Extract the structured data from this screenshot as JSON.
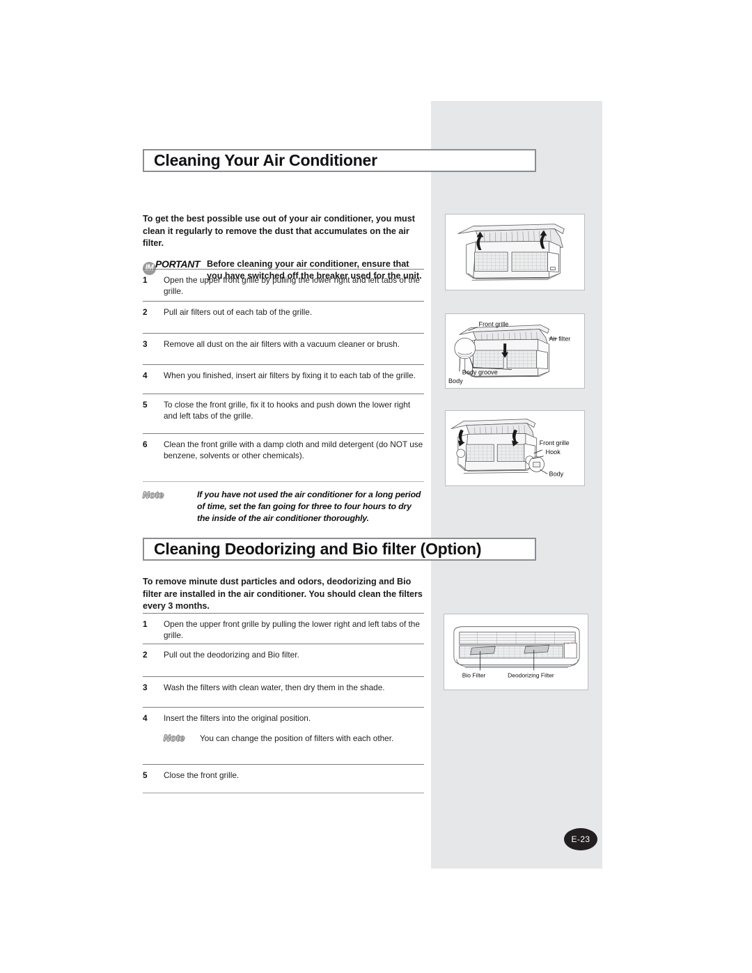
{
  "page": {
    "badge": "E-23"
  },
  "section1": {
    "heading": "Cleaning Your Air Conditioner",
    "intro": "To get the best possible use out of your air conditioner, you must clean it regularly to remove the dust that accumulates on the air filter.",
    "important": {
      "badge": "IM",
      "label": "PORTANT",
      "text": "Before cleaning your air conditioner, ensure that you have switched off the breaker used for the unit."
    },
    "steps": [
      {
        "num": "1",
        "text": "Open the upper front grille by pulling the lower right and left tabs of the grille."
      },
      {
        "num": "2",
        "text": "Pull air filters out of each tab of the grille."
      },
      {
        "num": "3",
        "text": "Remove all dust on the air filters with a vacuum cleaner or brush."
      },
      {
        "num": "4",
        "text": "When you finished, insert air filters by fixing it to each tab of the grille."
      },
      {
        "num": "5",
        "text": "To close the front grille, fix it to hooks and push down the lower right and left tabs of the grille."
      },
      {
        "num": "6",
        "text": "Clean the front grille with a damp cloth and mild detergent (do NOT use benzene, solvents or other chemicals)."
      }
    ],
    "note": {
      "label": "Note",
      "text": "If you have not used the air conditioner for a long period of time, set the fan going for three to four hours to dry the inside of the air conditioner thoroughly."
    }
  },
  "section2": {
    "heading": "Cleaning Deodorizing and Bio filter (Option)",
    "intro": "To remove minute dust particles and odors, deodorizing and Bio filter are installed in the air conditioner. You should clean the filters every 3 months.",
    "steps": [
      {
        "num": "1",
        "text": "Open the upper front grille by pulling the lower right and left tabs of the grille."
      },
      {
        "num": "2",
        "text": "Pull out the deodorizing and Bio filter."
      },
      {
        "num": "3",
        "text": "Wash the filters with clean water, then dry them in the shade."
      },
      {
        "num": "4",
        "text": "Insert the filters into the original position."
      },
      {
        "num": "5",
        "text": "Close the front grille."
      }
    ],
    "note": {
      "label": "Note",
      "text": "You can change the position of filters with each other."
    }
  },
  "illustrations": {
    "fig1": {
      "name": "front-grille-opening"
    },
    "fig2": {
      "name": "air-filter-removal",
      "labels": {
        "front_grille": "Front grille",
        "air_filter": "Air filter",
        "body_groove": "Body groove",
        "body": "Body"
      }
    },
    "fig3": {
      "name": "front-grille-closing",
      "labels": {
        "front_grille": "Front grille",
        "hook": "Hook",
        "body": "Body"
      }
    },
    "fig4": {
      "name": "bio-deodorizing-filters",
      "labels": {
        "bio_filter": "Bio Filter",
        "deodorizing_filter": "Deodorizing Filter"
      }
    }
  },
  "colors": {
    "panel": "#e6e7e8",
    "heading_border": "#8a8d93",
    "rule": "#7d7b86",
    "badge_bg": "#231f20",
    "im_badge": "#9b9b9b"
  }
}
